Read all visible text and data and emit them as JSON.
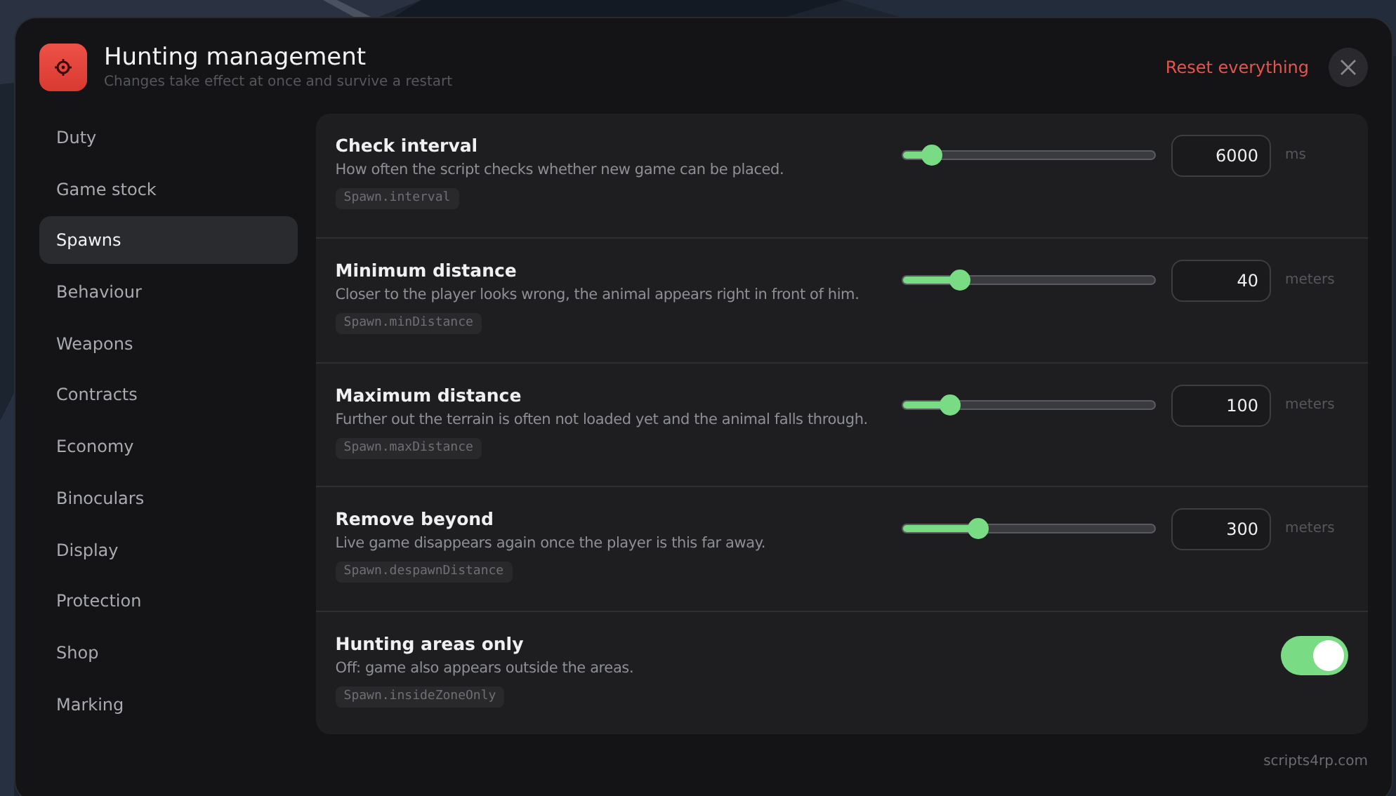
{
  "header": {
    "title": "Hunting management",
    "subtitle": "Changes take effect at once and survive a restart",
    "reset_label": "Reset everything"
  },
  "sidebar": {
    "items": [
      {
        "label": "Duty",
        "selected": false
      },
      {
        "label": "Game stock",
        "selected": false
      },
      {
        "label": "Spawns",
        "selected": true
      },
      {
        "label": "Behaviour",
        "selected": false
      },
      {
        "label": "Weapons",
        "selected": false
      },
      {
        "label": "Contracts",
        "selected": false
      },
      {
        "label": "Economy",
        "selected": false
      },
      {
        "label": "Binoculars",
        "selected": false
      },
      {
        "label": "Display",
        "selected": false
      },
      {
        "label": "Protection",
        "selected": false
      },
      {
        "label": "Shop",
        "selected": false
      },
      {
        "label": "Marking",
        "selected": false
      }
    ]
  },
  "settings": [
    {
      "kind": "slider",
      "title": "Check interval",
      "description": "How often the script checks whether new game can be placed.",
      "key": "Spawn.interval",
      "level": 0.12,
      "value": "6000",
      "unit": "ms"
    },
    {
      "kind": "slider",
      "title": "Minimum distance",
      "description": "Closer to the player looks wrong, the animal appears right in front of him.",
      "key": "Spawn.minDistance",
      "level": 0.23,
      "value": "40",
      "unit": "meters"
    },
    {
      "kind": "slider",
      "title": "Maximum distance",
      "description": "Further out the terrain is often not loaded yet and the animal falls through.",
      "key": "Spawn.maxDistance",
      "level": 0.19,
      "value": "100",
      "unit": "meters"
    },
    {
      "kind": "slider",
      "title": "Remove beyond",
      "description": "Live game disappears again once the player is this far away.",
      "key": "Spawn.despawnDistance",
      "level": 0.3,
      "value": "300",
      "unit": "meters"
    },
    {
      "kind": "toggle",
      "title": "Hunting areas only",
      "description": "Off: game also appears outside the areas.",
      "key": "Spawn.insideZoneOnly",
      "on": true
    }
  ],
  "footer": {
    "text": "scripts4rp.com"
  }
}
